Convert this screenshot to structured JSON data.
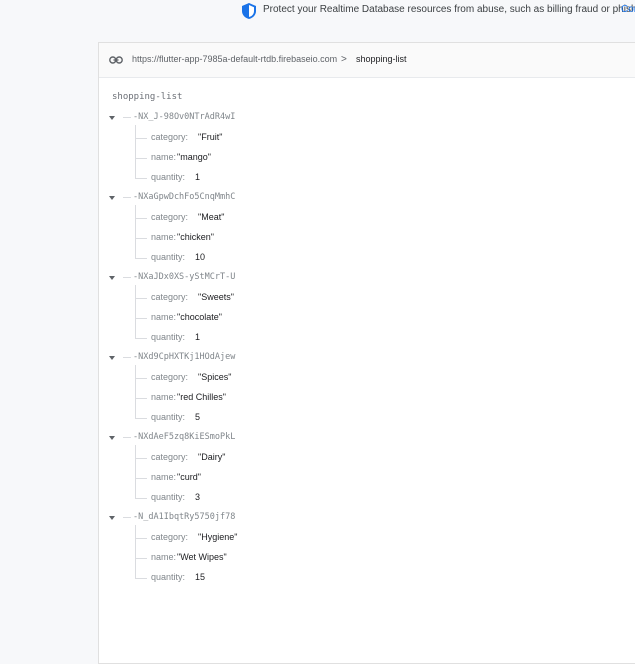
{
  "banner": {
    "message": "Protect your Realtime Database resources from abuse, such as billing fraud or phishing",
    "action": "Con",
    "icon": "shield-icon"
  },
  "urlbar": {
    "url": "https://flutter-app-7985a-default-rtdb.firebaseio.com",
    "separator": ">",
    "crumb": "shopping-list",
    "icon": "link-icon"
  },
  "tree": {
    "root": "shopping-list",
    "items": [
      {
        "key": "-NX_J-98Ov0NTrAdR4wI",
        "category": "\"Fruit\"",
        "name": "\"mango\"",
        "quantity": "1"
      },
      {
        "key": "-NXaGpwDchFo5CnqMmhC",
        "category": "\"Meat\"",
        "name": "\"chicken\"",
        "quantity": "10"
      },
      {
        "key": "-NXaJDx0XS-yStMCrT-U",
        "category": "\"Sweets\"",
        "name": "\"chocolate\"",
        "quantity": "1"
      },
      {
        "key": "-NXd9CpHXTKj1HOdAjew",
        "category": "\"Spices\"",
        "name": "\"red Chilles\"",
        "quantity": "5"
      },
      {
        "key": "-NXdAeF5zq8KiESmoPkL",
        "category": "\"Dairy\"",
        "name": "\"curd\"",
        "quantity": "3"
      },
      {
        "key": "-N_dA1IbqtRy5750jf78",
        "category": "\"Hygiene\"",
        "name": "\"Wet Wipes\"",
        "quantity": "15"
      }
    ],
    "labels": {
      "category": "category:",
      "name": "name:",
      "quantity": "quantity:"
    }
  },
  "colors": {
    "accent": "#1a73e8",
    "shield": "#1a73e8"
  }
}
